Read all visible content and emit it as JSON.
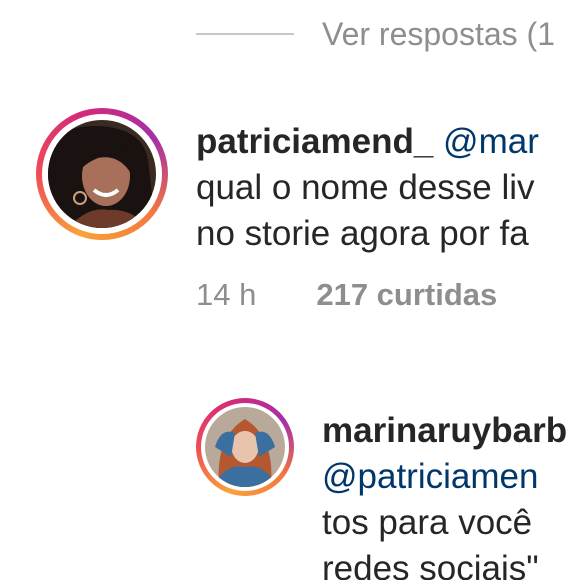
{
  "view_replies": {
    "label": "Ver respostas (1"
  },
  "comments": [
    {
      "username": "patriciamend_",
      "mention": "@mar",
      "lines": [
        "qual o nome desse liv",
        "no storie agora por fa"
      ],
      "time": "14 h",
      "likes": "217 curtidas",
      "avatar_icon": "profile-photo-woman-dark-hair"
    },
    {
      "username": "marinaruybarb",
      "mention": "@patriciamen",
      "lines": [
        "tos para você",
        "redes sociais\""
      ],
      "avatar_icon": "profile-photo-woman-red-hair"
    }
  ],
  "colors": {
    "story_ring_start": "#f9a23a",
    "story_ring_end": "#d3297a",
    "mention": "#00376b",
    "secondary_text": "#8e8e8e"
  }
}
